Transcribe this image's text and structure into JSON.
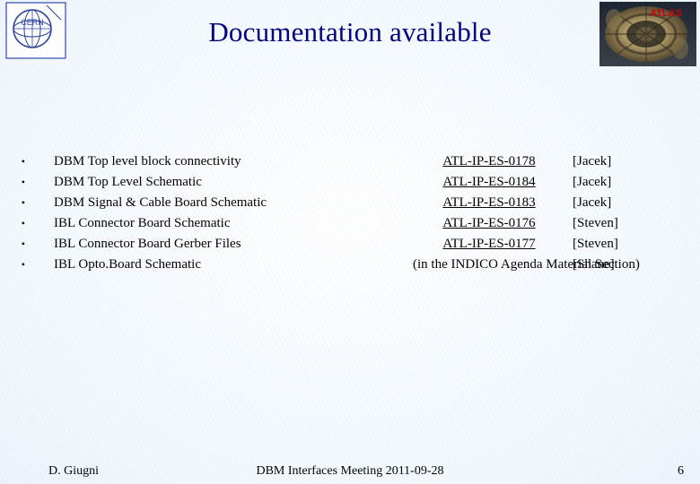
{
  "slide": {
    "title": "Documentation available",
    "page_number": "6"
  },
  "logos": {
    "cern_label": "CERN",
    "atlas_label": "ATLAS"
  },
  "list": [
    {
      "bullet": "•",
      "text": "DBM Top level block connectivity",
      "doc_id": "ATL-IP-ES-0178",
      "doc_id_is_link": true,
      "owner": "[Jacek]"
    },
    {
      "bullet": "•",
      "text": "DBM Top Level Schematic",
      "doc_id": "ATL-IP-ES-0184",
      "doc_id_is_link": true,
      "owner": "[Jacek]"
    },
    {
      "bullet": "•",
      "text": "DBM Signal & Cable Board Schematic",
      "doc_id": "ATL-IP-ES-0183",
      "doc_id_is_link": true,
      "owner": "[Jacek]"
    },
    {
      "bullet": "•",
      "text": "IBL Connector Board Schematic",
      "doc_id": "ATL-IP-ES-0176",
      "doc_id_is_link": true,
      "owner": "[Steven]"
    },
    {
      "bullet": "•",
      "text": "IBL Connector Board Gerber Files",
      "doc_id": "ATL-IP-ES-0177",
      "doc_id_is_link": true,
      "owner": "[Steven]"
    },
    {
      "bullet": "•",
      "text": "IBL Opto.Board Schematic",
      "doc_id": "(in the INDICO Agenda Material Section)",
      "doc_id_is_link": false,
      "owner": "[Shane]"
    }
  ],
  "footer": {
    "author": "D. Giugni",
    "meeting": "DBM Interfaces Meeting 2011-09-28",
    "page": "6"
  },
  "colors": {
    "title": "#000080",
    "background_edge": "#dce9f7",
    "atlas_text": "#cc0000"
  }
}
